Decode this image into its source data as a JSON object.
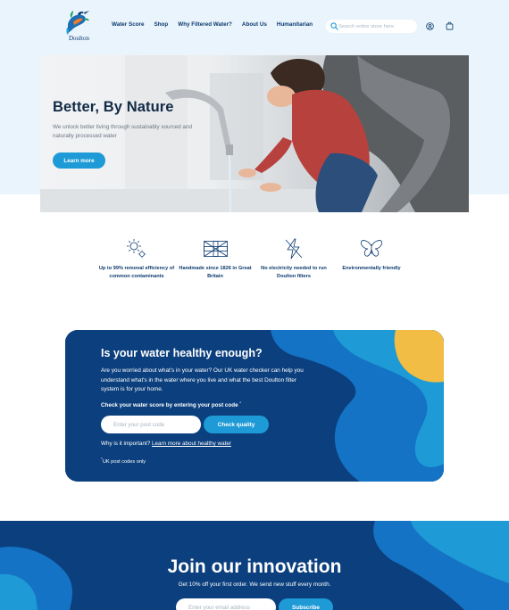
{
  "brand": {
    "logo_text": "Doulton",
    "colors": {
      "navy": "#0b3a6e",
      "accent": "#1e9ad6",
      "sky": "#eaf4fc",
      "yellow": "#f2bd44"
    }
  },
  "nav": {
    "items": [
      {
        "label": "Water Score"
      },
      {
        "label": "Shop"
      },
      {
        "label": "Why Filtered Water?"
      },
      {
        "label": "About Us"
      },
      {
        "label": "Humanitarian"
      }
    ]
  },
  "search": {
    "placeholder": "Search entire store here",
    "icon": "search-icon"
  },
  "header_icons": [
    "user-icon",
    "shopping-bag-icon"
  ],
  "hero": {
    "title": "Better, By Nature",
    "subtitle": "We unlock better living through sustainably sourced and naturally processed water",
    "button_label": "Learn more"
  },
  "features": [
    {
      "icon": "sparkle-filter-icon",
      "label": "Up to 99% removal efficiency of common contaminants"
    },
    {
      "icon": "union-flag-icon",
      "label": "Handmade since 1826 in Great Britain"
    },
    {
      "icon": "no-electricity-icon",
      "label": "No electricity needed to run Doulton filters"
    },
    {
      "icon": "butterfly-icon",
      "label": "Environmentally friendly"
    }
  ],
  "water_check": {
    "title": "Is your water healthy enough?",
    "description": "Are you worried about what's in your water? Our UK water checker can help you understand what's in the water where you live and what the best Doulton filter system is for your home.",
    "prompt": "Check your water score by entering your post code",
    "prompt_mark": "*",
    "postcode_placeholder": "Enter your post code",
    "button_label": "Check quality",
    "why_text": "Why is it important?",
    "why_link": "Learn more about healthy water",
    "note_mark": "*",
    "note": "UK post codes only"
  },
  "newsletter": {
    "title": "Join our innovation",
    "subtitle": "Get 10% off your first order. We send new stuff every month.",
    "email_placeholder": "Enter your email address",
    "button_label": "Subscribe"
  }
}
